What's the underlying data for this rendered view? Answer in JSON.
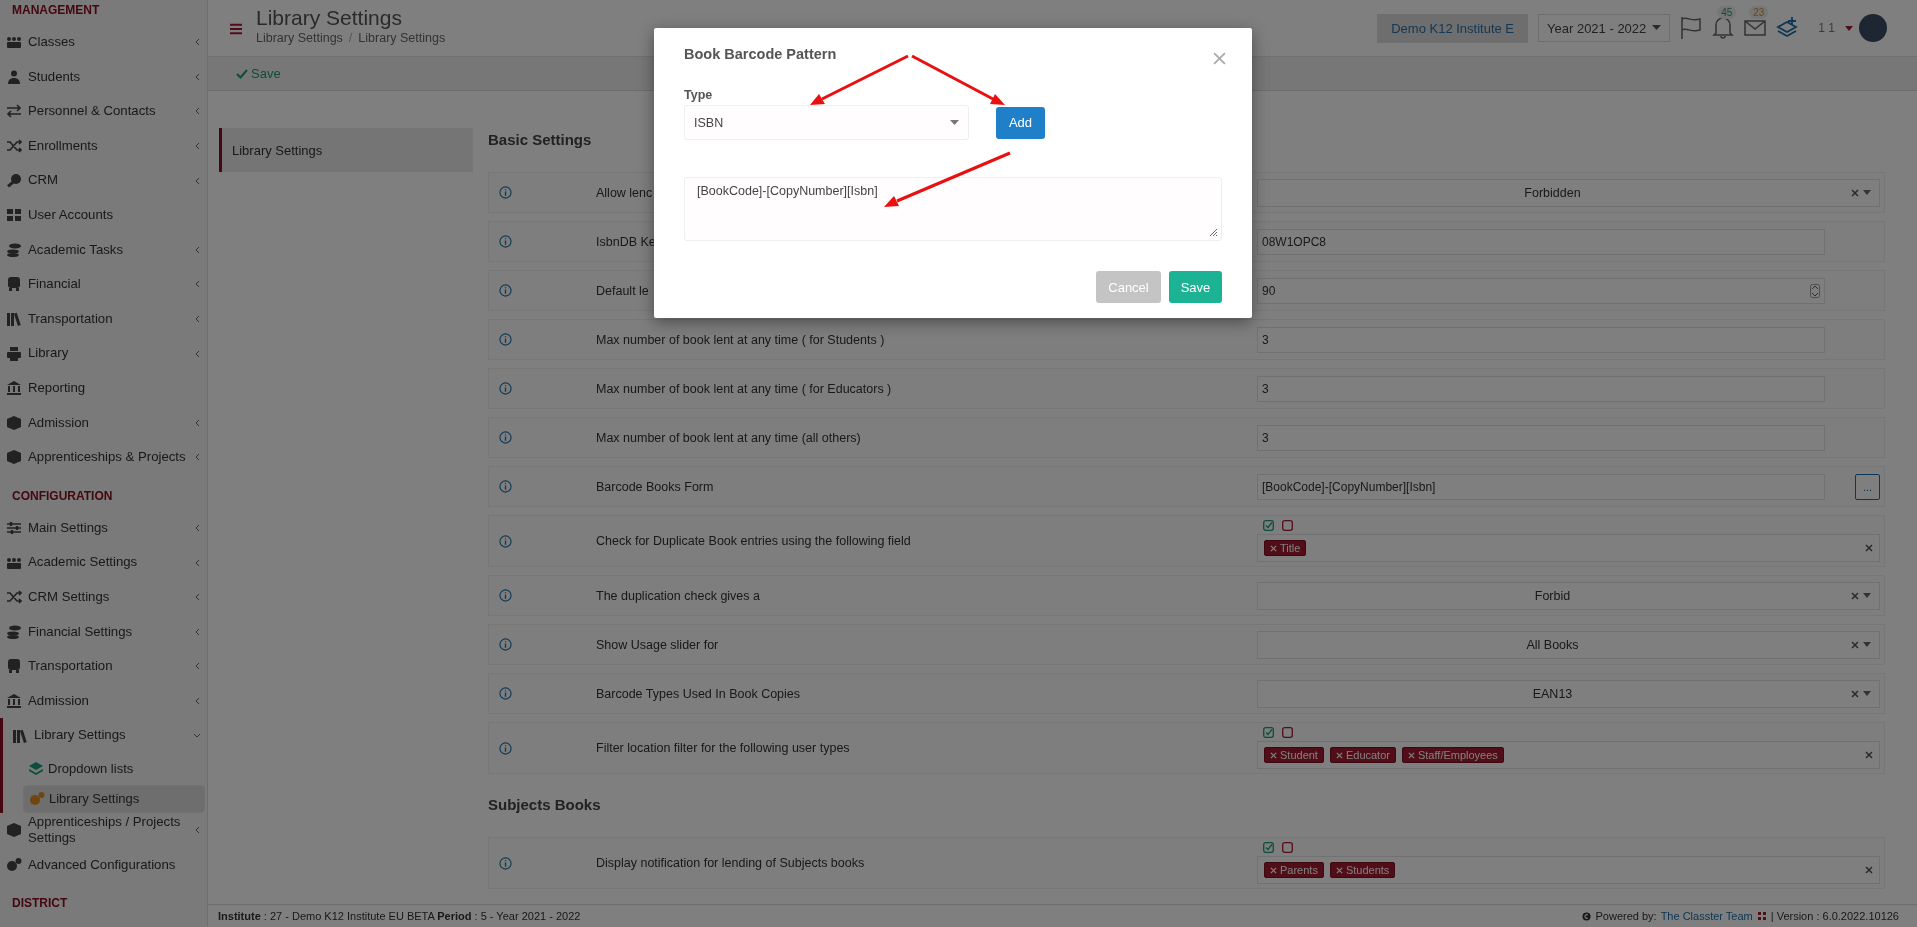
{
  "sidebar": {
    "sections": [
      {
        "heading": "MANAGEMENT",
        "items": [
          {
            "label": "Classes",
            "expandable": true,
            "expanded": false,
            "selected": false
          },
          {
            "label": "Students",
            "expandable": true,
            "expanded": false,
            "selected": false
          },
          {
            "label": "Personnel & Contacts",
            "expandable": true,
            "expanded": false,
            "selected": false
          },
          {
            "label": "Enrollments",
            "expandable": true,
            "expanded": false,
            "selected": false
          },
          {
            "label": "CRM",
            "expandable": true,
            "expanded": false,
            "selected": false
          },
          {
            "label": "User Accounts",
            "expandable": false,
            "expanded": false,
            "selected": false
          },
          {
            "label": "Academic Tasks",
            "expandable": true,
            "expanded": false,
            "selected": false
          },
          {
            "label": "Financial",
            "expandable": true,
            "expanded": false,
            "selected": false
          },
          {
            "label": "Transportation",
            "expandable": true,
            "expanded": false,
            "selected": false
          },
          {
            "label": "Library",
            "expandable": true,
            "expanded": false,
            "selected": false
          },
          {
            "label": "Reporting",
            "expandable": false,
            "expanded": false,
            "selected": false
          },
          {
            "label": "Admission",
            "expandable": true,
            "expanded": false,
            "selected": false
          },
          {
            "label": "Apprenticeships & Projects",
            "expandable": true,
            "expanded": false,
            "selected": false
          }
        ]
      },
      {
        "heading": "CONFIGURATION",
        "items": [
          {
            "label": "Main Settings",
            "expandable": true,
            "expanded": false,
            "selected": false
          },
          {
            "label": "Academic Settings",
            "expandable": true,
            "expanded": false,
            "selected": false
          },
          {
            "label": "CRM Settings",
            "expandable": true,
            "expanded": false,
            "selected": false
          },
          {
            "label": "Financial Settings",
            "expandable": true,
            "expanded": false,
            "selected": false
          },
          {
            "label": "Transportation",
            "expandable": true,
            "expanded": false,
            "selected": false
          },
          {
            "label": "Admission",
            "expandable": true,
            "expanded": false,
            "selected": false
          },
          {
            "label": "Library Settings",
            "expandable": true,
            "expanded": true,
            "selected": false,
            "children": [
              {
                "label": "Dropdown lists",
                "selected": false
              },
              {
                "label": "Library Settings",
                "selected": true
              }
            ]
          },
          {
            "label": "Apprenticeships / Projects Settings",
            "expandable": true,
            "expanded": false,
            "selected": false
          },
          {
            "label": "Advanced Configurations",
            "expandable": false,
            "expanded": false,
            "selected": false
          }
        ]
      },
      {
        "heading": "DISTRICT"
      }
    ]
  },
  "header": {
    "title": "Library Settings",
    "breadcrumb": [
      "Library Settings",
      "Library Settings"
    ],
    "breadcrumb_separator": "/",
    "institute": "Demo K12 Institute E",
    "year": "Year 2021 - 2022",
    "notifications": "45",
    "messages": "23",
    "user": "1 1"
  },
  "toolbar": {
    "save": "Save"
  },
  "tabs": [
    {
      "label": "Library Settings",
      "selected": true
    }
  ],
  "sections": [
    {
      "title": "Basic Settings",
      "rows": [
        {
          "kind": "select",
          "label": "Allow lenc",
          "value": "Forbidden"
        },
        {
          "kind": "text",
          "label": "IsbnDB Ke",
          "value": "08W1OPC8"
        },
        {
          "kind": "number",
          "label": "Default le",
          "value": "90"
        },
        {
          "kind": "text",
          "label": "Max number of book lent at any time ( for Students )",
          "value": "3"
        },
        {
          "kind": "text",
          "label": "Max number of book lent at any time ( for Educators )",
          "value": "3"
        },
        {
          "kind": "text",
          "label": "Max number of book lent at any time (all others)",
          "value": "3"
        },
        {
          "kind": "text-button",
          "label": "Barcode Books Form",
          "value": "[BookCode]-[CopyNumber][Isbn]",
          "button": "..."
        },
        {
          "kind": "tags",
          "label": "Check for Duplicate Book entries using the following field",
          "tags": [
            "Title"
          ]
        },
        {
          "kind": "select",
          "label": "The duplication check gives a",
          "value": "Forbid"
        },
        {
          "kind": "select",
          "label": "Show Usage slider for",
          "value": "All Books"
        },
        {
          "kind": "select",
          "label": "Barcode Types Used In Book Copies",
          "value": "EAN13"
        },
        {
          "kind": "tags",
          "label": "Filter location filter for the following user types",
          "tags": [
            "Student",
            "Educator",
            "Staff/Employees"
          ]
        }
      ]
    },
    {
      "title": "Subjects Books",
      "rows": [
        {
          "kind": "tags",
          "label": "Display notification for lending of Subjects books",
          "tags": [
            "Parents",
            "Students"
          ]
        }
      ]
    }
  ],
  "footer": {
    "info": "**Institute** : 27 - Demo K12 Institute EU BETA **Period** : 5 - Year 2021 - 2022",
    "powered": "Powered by:",
    "team": "The Classter Team",
    "version": "| Version : 6.0.2022.10126"
  },
  "modal": {
    "title": "Book Barcode Pattern",
    "type_label": "Type",
    "type_value": "ISBN",
    "add": "Add",
    "pattern": "[BookCode]-[CopyNumber][Isbn]",
    "cancel": "Cancel",
    "save": "Save"
  }
}
